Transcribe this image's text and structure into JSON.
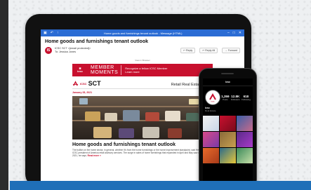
{
  "email_window": {
    "titlebar_text": "Home goods and furnishings tenant outlook - Message (HTML)",
    "subject": "Home goods and furnishings tenant outlook",
    "sender": "ICSC SCT <[email protected]>",
    "recipient": "To: Jessica Jones",
    "avatar_initials": "IS",
    "actions": {
      "reply": "Reply",
      "reply_all": "Reply All",
      "forward": "Forward"
    },
    "view_in_browser": "View in Browser",
    "banner": {
      "logo_text": "icsc",
      "title_line1": "MEMBER",
      "title_line2": "MOMENTS",
      "cta": "Recognize a fellow ICSC Member",
      "cta_link": "Learn more"
    },
    "newsletter": {
      "brand_org": "ICSC",
      "brand_name": "SCT",
      "section": "Retail Real Estate News"
    },
    "date": "January 28, 2021",
    "article_title": "Home goods and furnishings tenant outlook",
    "article_body": "The bullish on the home sector, in general, whether it's from the home furnishings or the home improvement standpoint, said Herman Jang, ICSC president of America retail advisory services. The surge in sales of home furnishings that expanded in April and May saw continue into 2021, he says.",
    "read_more": "Read more »"
  },
  "phone": {
    "header": "icsc",
    "avatar_text": "icsc",
    "stats": [
      {
        "num": "1,359",
        "label": "Posts"
      },
      {
        "num": "12.8K",
        "label": "Followers"
      },
      {
        "num": "618",
        "label": "Following"
      }
    ],
    "profile_name": "icsc",
    "profile_sub": "Real Estate"
  },
  "colors": {
    "brand_red": "#c8102e",
    "titlebar_blue": "#2b6cd4",
    "band_blue": "#1f6fb8"
  }
}
